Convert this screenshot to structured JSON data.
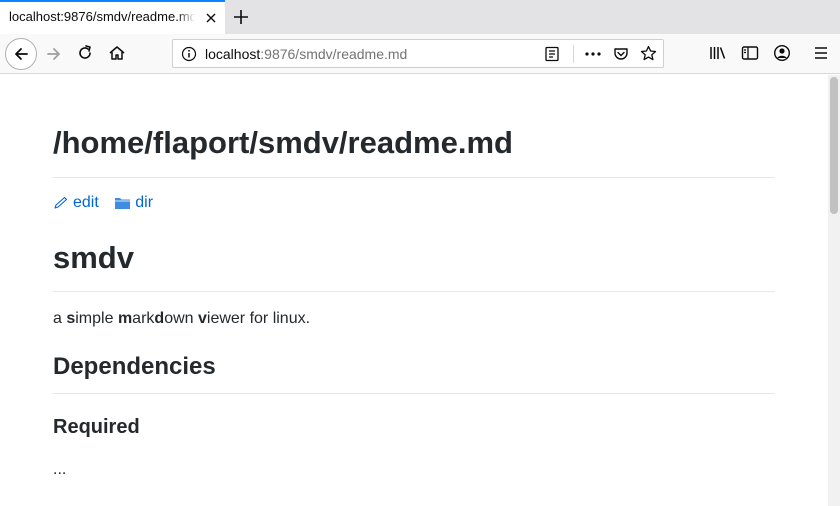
{
  "tab": {
    "title": "localhost:9876/smdv/readme.md"
  },
  "urlbar": {
    "host": "localhost",
    "path": ":9876/smdv/readme.md"
  },
  "icons": {
    "tab_close": "close-icon",
    "new_tab": "plus-icon",
    "back": "back-arrow-icon",
    "forward": "forward-arrow-icon",
    "reload": "reload-icon",
    "home": "home-icon",
    "site_info": "info-icon",
    "reader": "reader-view-icon",
    "page_actions": "more-icon",
    "pocket": "pocket-icon",
    "bookmark": "star-icon",
    "library": "library-icon",
    "sidebar": "sidebar-icon",
    "account": "account-icon",
    "menu": "hamburger-menu-icon",
    "edit": "pencil-icon",
    "dir": "folder-icon"
  },
  "colors": {
    "link": "#0366d6",
    "text": "#24292e",
    "tab_accent": "#0a84ff"
  },
  "document": {
    "path_heading": "/home/flaport/smdv/readme.md",
    "edit_label": "edit",
    "dir_label": "dir",
    "title": "smdv",
    "tagline": {
      "p1": "a ",
      "b1": "s",
      "p2": "imple ",
      "b2": "m",
      "p3": "ark",
      "b3": "d",
      "p4": "own ",
      "b4": "v",
      "p5": "iewer for linux."
    },
    "section_heading": "Dependencies",
    "subsection_heading": "Required",
    "ellipsis": "..."
  }
}
